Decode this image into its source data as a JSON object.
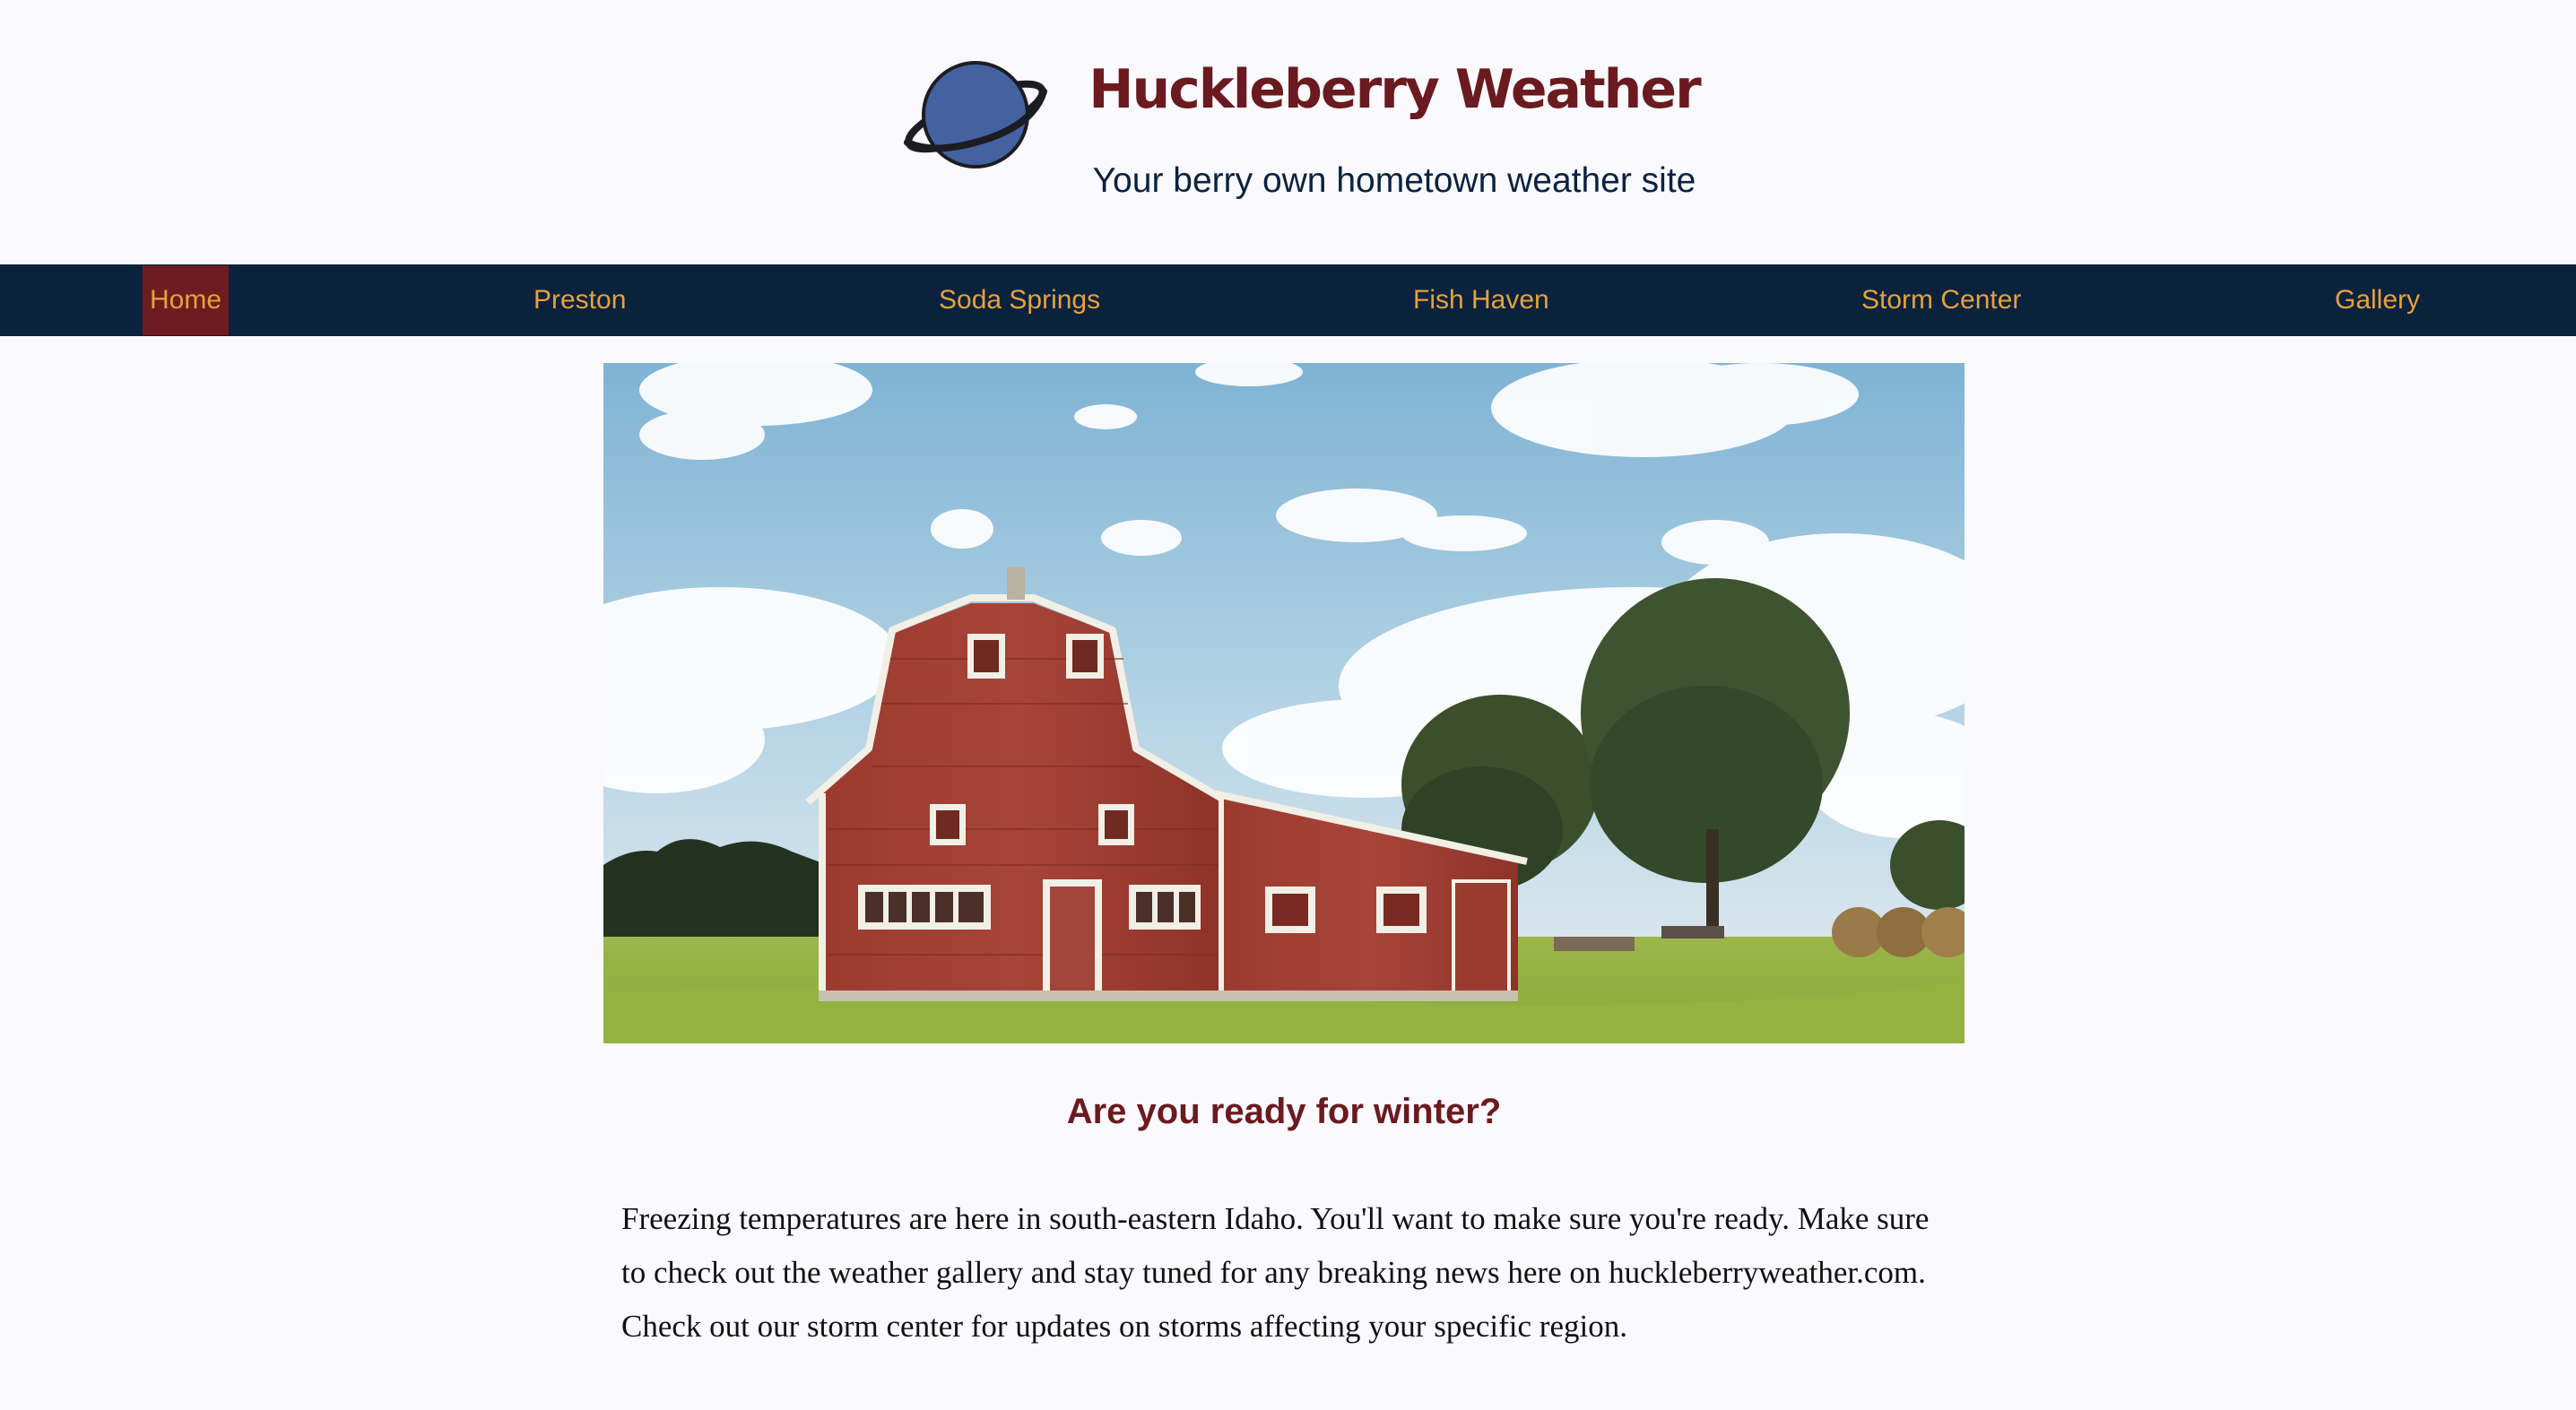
{
  "header": {
    "title": "Huckleberry Weather",
    "tagline": "Your berry own hometown weather site",
    "logo_icon": "planet-icon"
  },
  "nav": {
    "items": [
      {
        "label": "Home",
        "active": true
      },
      {
        "label": "Preston",
        "active": false
      },
      {
        "label": "Soda Springs",
        "active": false
      },
      {
        "label": "Fish Haven",
        "active": false
      },
      {
        "label": "Storm Center",
        "active": false
      },
      {
        "label": "Gallery",
        "active": false
      }
    ]
  },
  "main": {
    "hero_image": "red-barn-photo",
    "headline": "Are you ready for winter?",
    "body": "Freezing temperatures are here in south-eastern Idaho. You'll want to make sure you're ready. Make sure to check out the weather gallery and stay tuned for any breaking news here on huckleberryweather.com. Check out our storm center for updates on storms affecting your specific region."
  },
  "colors": {
    "background": "#f9f9fe",
    "brand_maroon": "#6b1a1f",
    "nav_navy": "#0b223d",
    "nav_link": "#e6a13a",
    "active_bg": "#6e1c21"
  }
}
